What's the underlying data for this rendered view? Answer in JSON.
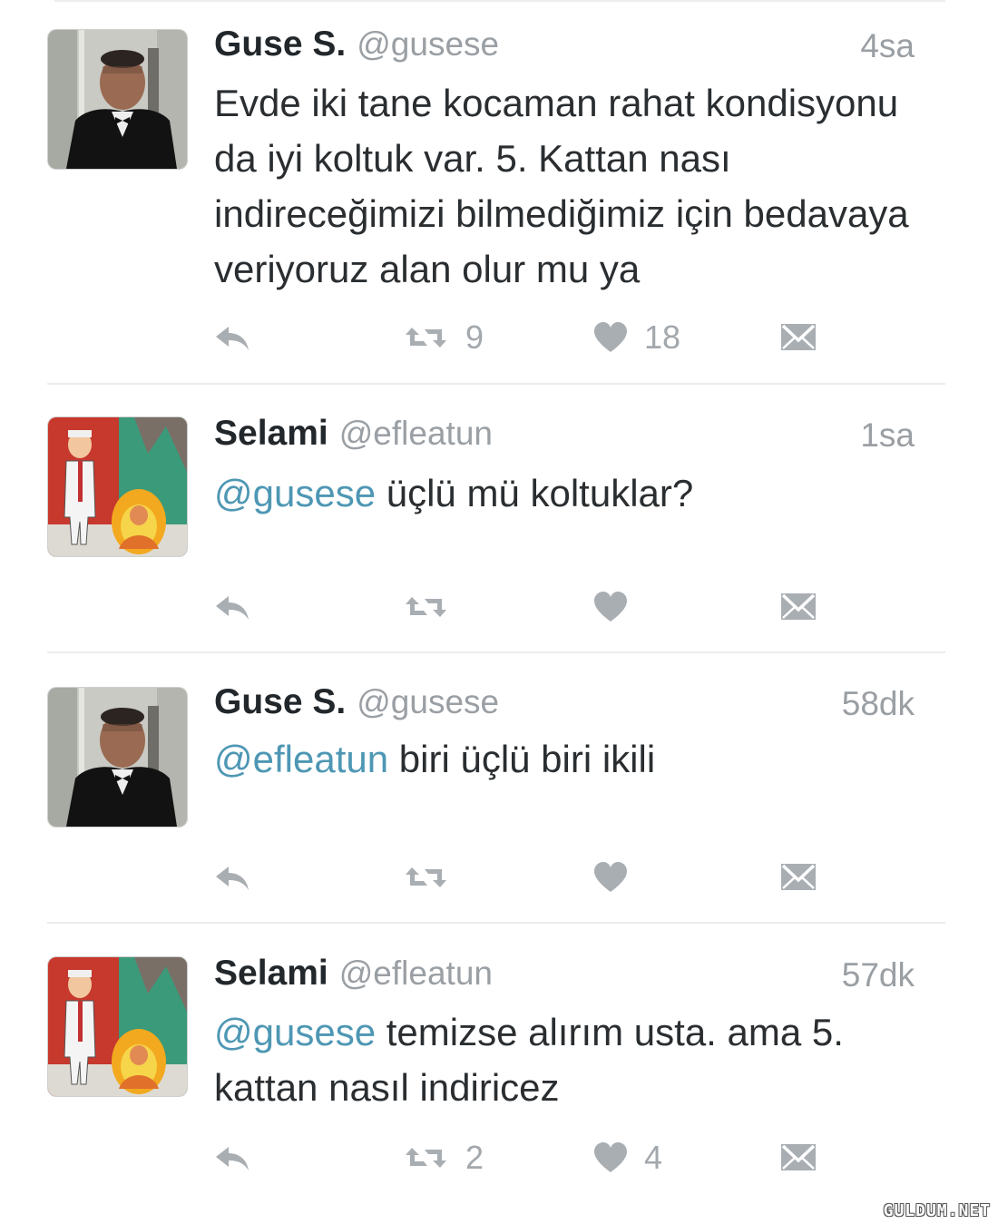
{
  "tweets": [
    {
      "name": "Guse S.",
      "handle": "@gusese",
      "time": "4sa",
      "mention": "",
      "text": "Evde iki tane kocaman rahat kondisyonu da iyi koltuk var. 5. Kattan nası indireceğimizi bilmediğimiz için bedavaya veriyoruz alan olur mu ya",
      "retweets": "9",
      "likes": "18"
    },
    {
      "name": "Selami",
      "handle": "@efleatun",
      "time": "1sa",
      "mention": "@gusese",
      "text": " üçlü mü koltuklar?",
      "retweets": "",
      "likes": ""
    },
    {
      "name": "Guse S.",
      "handle": "@gusese",
      "time": "58dk",
      "mention": "@efleatun",
      "text": " biri üçlü biri ikili",
      "retweets": "",
      "likes": ""
    },
    {
      "name": "Selami",
      "handle": "@efleatun",
      "time": "57dk",
      "mention": "@gusese",
      "text": " temizse alırım usta. ama 5. kattan nasıl indiricez",
      "retweets": "2",
      "likes": "4"
    }
  ],
  "icons": {
    "reply": "reply-icon",
    "retweet": "retweet-icon",
    "like": "heart-icon",
    "message": "envelope-icon"
  },
  "colors": {
    "mention": "#4e97b4",
    "icon": "#a9aeb3",
    "name": "#22272b",
    "meta": "#9a9fa4"
  },
  "watermark": "GULDUM.NET"
}
